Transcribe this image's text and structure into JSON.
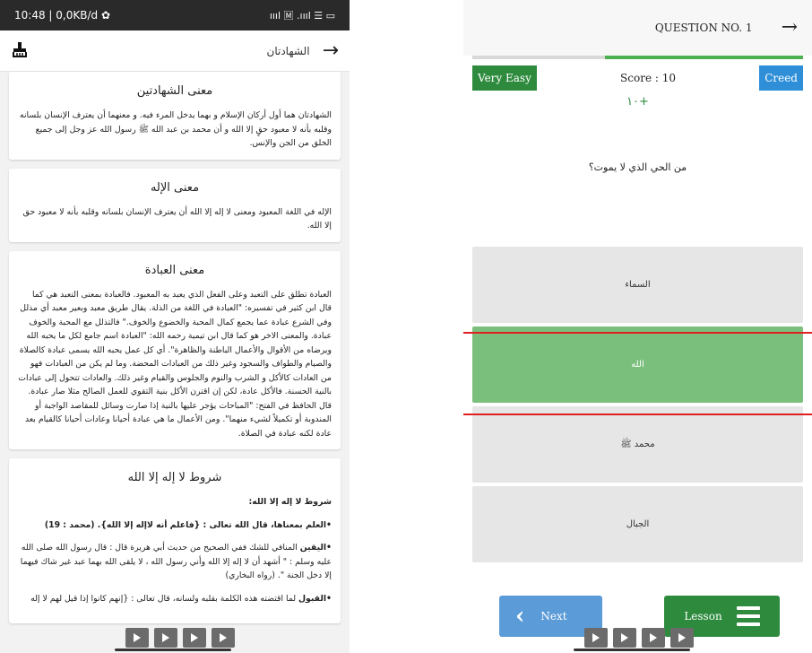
{
  "left_screen": {
    "status": {
      "time_speed": "10:48 | 0,0KB/d",
      "gear": "✿",
      "signal": "ıııl 🄼 .ıııl ☰ ▭"
    },
    "header": {
      "title": "الشهادتان"
    },
    "cards": [
      {
        "title": "معنى الشهادتين",
        "paragraphs": [
          "الشهادتان هما أول أركان الإسلام و بهما يدخل المرء فيه. و معنهما أن يعترف الإنسان بلسانه وقلبه بأنه لا معبود حقٍ إلا الله و أن محمد بن عبد الله ﷺ رسول الله عز وجل إلى جميع الخلق من الجن والإنس."
        ]
      },
      {
        "title": "معنى الإله",
        "paragraphs": [
          "الإله في اللغة المعبود ومعنى لا إله إلا الله أن يعترف الإنسان بلسانه وقلبه بأنه لا معبود حق إلا الله."
        ]
      },
      {
        "title": "معنى العبادة",
        "paragraphs": [
          "العبادة تطلق على التعبد وعلى الفعل الذي يعبد به المعبود. فالعبادة بمعنى التعبد هي كما قال ابن كثير في تفسيره: \"العبادة في اللغة من الذلة. يقال طريق معبد وبعير معبد أي مذلل وفي الشرع عبادة عما يجمع كمال المحبة والخضوع والخوف.\" فالتذلل مع المحبة والخوف عبادة. والمعنى الاخر هو كما قال ابن تيمية رحمه الله: \"العبادة اسم جامع لكل ما يحبه الله ويرضاه من الأقوال والأعمال الباطنة والظاهرة\". أي كل عمل يحبه الله يسمى عبادة كالصلاة والصيام والطواف والسجود وغير ذلك من العبادات المحضة. وما لم يكن من العبادات فهو من العادات كالأكل و الشرب والنوم والجلوس والقيام وغير ذلك. والعادات تتحول إلى عبادات بالنية الحسنة. فالأكل عادة، لكن إن اقترن الأكل بنية التقوي للعمل الصالح مثلا صار عبادة. قال الحافظ في الفتح: \"المباحات يؤجر عليها بالنية إذا صارت وسائل للمقاصد الواجبة أو المندوبة أو تكميلاً لشيء منهما\". ومن الأعمال ما هي عبادة أحيانا وعادات أحيانا كالقيام بعد عادة لكنه عبادة في الصلاة."
        ]
      },
      {
        "title": "شروط لا إله إلا الله",
        "subtitle": "شروط لا إله إلا الله:",
        "p1": "•العلم بمعناها، قال الله تعالى : {فاعلم أنه لاإله إلا الله}. (محمد : 19)",
        "p2_bold": "•اليقين",
        "p2": " المنافي للشك ففي الصحيح من حديث أبي هريرة قال : قال رسول الله صلى الله عليه وسلم : \" أشهد أن لا إله إلا الله وأني رسول الله ، لا يلقى الله بهما عبد غير شاك فيهما إلا دخل الجنة \". (رواه البخاري)",
        "p3_bold": "•القبول",
        "p3": " لما اقتضته هذه الكلمة بقلبه ولسانه، قال تعالى : {إنهم كانوا إذا قيل لهم لا إله"
      }
    ]
  },
  "right_screen": {
    "header": {
      "label": "QUESTION NO. 1"
    },
    "progress": {
      "fraction": 0.6
    },
    "difficulty": "Very Easy",
    "score_text": "Score : 10",
    "category": "Creed",
    "points_gain": "١٠+",
    "question": "من الحي الذي لا يموت؟",
    "options": [
      "السماء",
      "الله",
      "محمد ﷺ",
      "الجبال"
    ],
    "correct_index": 1,
    "next_label": "Next",
    "lesson_label": "Lesson",
    "colors": {
      "green": "#2e8b3e",
      "blue": "#2e8fd8",
      "correct": "#7bbf7d",
      "highlight": "#e02020"
    }
  }
}
